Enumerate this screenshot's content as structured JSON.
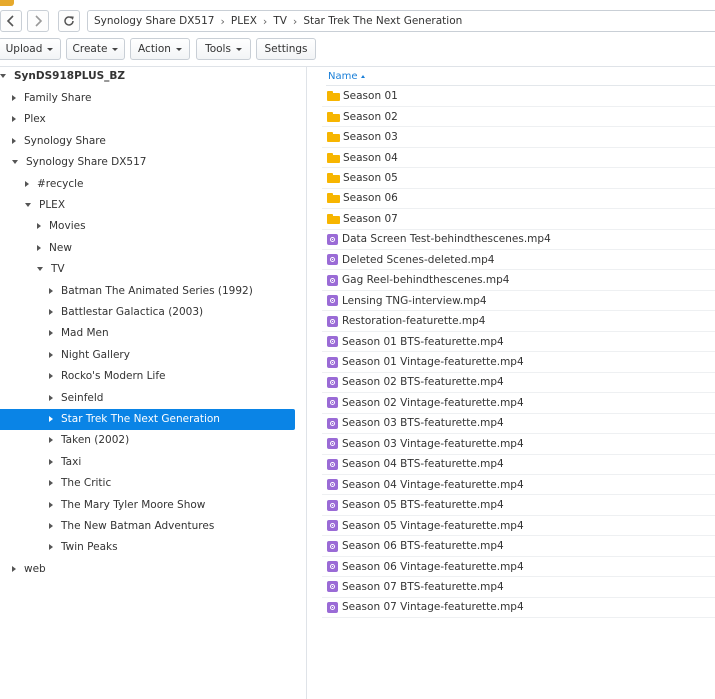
{
  "breadcrumb": [
    "Synology Share DX517",
    "PLEX",
    "TV",
    "Star Trek The Next Generation"
  ],
  "icons": {
    "back": "chevron-left-icon",
    "forward": "chevron-right-icon",
    "refresh": "refresh-icon",
    "folder": "folder-icon",
    "video": "video-file-icon"
  },
  "colors": {
    "selection": "#0a84e6",
    "folder": "#f7b500",
    "video": "#9a6bd6",
    "header_link": "#1a7fd8"
  },
  "toolbar": {
    "upload": "Upload",
    "create": "Create",
    "action": "Action",
    "tools": "Tools",
    "settings": "Settings"
  },
  "tree": {
    "root": "SynDS918PLUS_BZ",
    "items": [
      {
        "label": "Family Share",
        "state": "collapsed"
      },
      {
        "label": "Plex",
        "state": "collapsed"
      },
      {
        "label": "Synology Share",
        "state": "collapsed"
      },
      {
        "label": "Synology Share DX517",
        "state": "expanded"
      },
      {
        "label": "#recycle",
        "state": "collapsed"
      },
      {
        "label": "PLEX",
        "state": "expanded"
      },
      {
        "label": "Movies",
        "state": "collapsed"
      },
      {
        "label": "New",
        "state": "collapsed"
      },
      {
        "label": "TV",
        "state": "expanded"
      },
      {
        "label": "Batman The Animated Series (1992)",
        "state": "collapsed"
      },
      {
        "label": "Battlestar Galactica (2003)",
        "state": "collapsed"
      },
      {
        "label": "Mad Men",
        "state": "collapsed"
      },
      {
        "label": "Night Gallery",
        "state": "collapsed"
      },
      {
        "label": "Rocko's Modern Life",
        "state": "collapsed"
      },
      {
        "label": "Seinfeld",
        "state": "collapsed"
      },
      {
        "label": "Star Trek The Next Generation",
        "state": "collapsed",
        "selected": true
      },
      {
        "label": "Taken (2002)",
        "state": "collapsed"
      },
      {
        "label": "Taxi",
        "state": "collapsed"
      },
      {
        "label": "The Critic",
        "state": "collapsed"
      },
      {
        "label": "The Mary Tyler Moore Show",
        "state": "collapsed"
      },
      {
        "label": "The New Batman Adventures",
        "state": "collapsed"
      },
      {
        "label": "Twin Peaks",
        "state": "collapsed"
      },
      {
        "label": "web",
        "state": "collapsed"
      }
    ]
  },
  "list": {
    "column_name": "Name",
    "sort": "ascending",
    "items": [
      {
        "name": "Season 01",
        "type": "folder"
      },
      {
        "name": "Season 02",
        "type": "folder"
      },
      {
        "name": "Season 03",
        "type": "folder"
      },
      {
        "name": "Season 04",
        "type": "folder"
      },
      {
        "name": "Season 05",
        "type": "folder"
      },
      {
        "name": "Season 06",
        "type": "folder"
      },
      {
        "name": "Season 07",
        "type": "folder"
      },
      {
        "name": "Data Screen Test-behindthescenes.mp4",
        "type": "video"
      },
      {
        "name": "Deleted Scenes-deleted.mp4",
        "type": "video"
      },
      {
        "name": "Gag Reel-behindthescenes.mp4",
        "type": "video"
      },
      {
        "name": "Lensing TNG-interview.mp4",
        "type": "video"
      },
      {
        "name": "Restoration-featurette.mp4",
        "type": "video"
      },
      {
        "name": "Season 01 BTS-featurette.mp4",
        "type": "video"
      },
      {
        "name": "Season 01 Vintage-featurette.mp4",
        "type": "video"
      },
      {
        "name": "Season 02 BTS-featurette.mp4",
        "type": "video"
      },
      {
        "name": "Season 02 Vintage-featurette.mp4",
        "type": "video"
      },
      {
        "name": "Season 03 BTS-featurette.mp4",
        "type": "video"
      },
      {
        "name": "Season 03 Vintage-featurette.mp4",
        "type": "video"
      },
      {
        "name": "Season 04 BTS-featurette.mp4",
        "type": "video"
      },
      {
        "name": "Season 04 Vintage-featurette.mp4",
        "type": "video"
      },
      {
        "name": "Season 05 BTS-featurette.mp4",
        "type": "video"
      },
      {
        "name": "Season 05 Vintage-featurette.mp4",
        "type": "video"
      },
      {
        "name": "Season 06 BTS-featurette.mp4",
        "type": "video"
      },
      {
        "name": "Season 06 Vintage-featurette.mp4",
        "type": "video"
      },
      {
        "name": "Season 07 BTS-featurette.mp4",
        "type": "video"
      },
      {
        "name": "Season 07 Vintage-featurette.mp4",
        "type": "video"
      }
    ]
  }
}
